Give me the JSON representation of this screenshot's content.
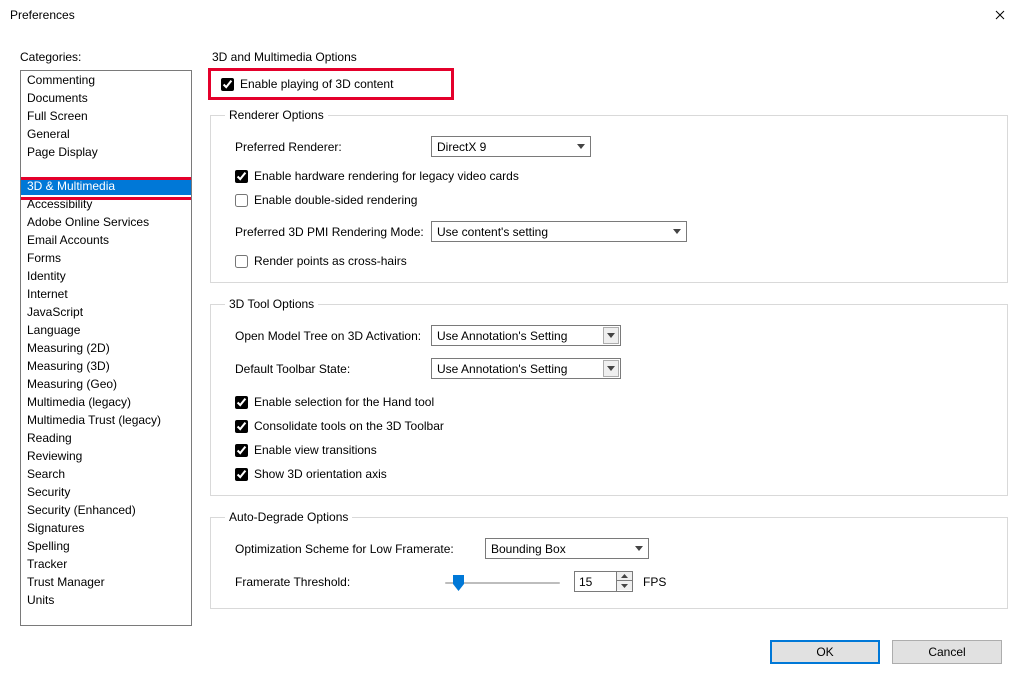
{
  "window": {
    "title": "Preferences"
  },
  "sidebar": {
    "label": "Categories:",
    "group1": [
      "Commenting",
      "Documents",
      "Full Screen",
      "General",
      "Page Display"
    ],
    "group2": [
      "3D & Multimedia",
      "Accessibility",
      "Adobe Online Services",
      "Email Accounts",
      "Forms",
      "Identity",
      "Internet",
      "JavaScript",
      "Language",
      "Measuring (2D)",
      "Measuring (3D)",
      "Measuring (Geo)",
      "Multimedia (legacy)",
      "Multimedia Trust (legacy)",
      "Reading",
      "Reviewing",
      "Search",
      "Security",
      "Security (Enhanced)",
      "Signatures",
      "Spelling",
      "Tracker",
      "Trust Manager",
      "Units"
    ],
    "selected": "3D & Multimedia"
  },
  "main": {
    "title": "3D and Multimedia Options",
    "enable3d": {
      "label": "Enable playing of 3D content",
      "checked": true
    },
    "renderer": {
      "legend": "Renderer Options",
      "preferred_label": "Preferred Renderer:",
      "preferred_value": "DirectX 9",
      "hw_legacy": {
        "label": "Enable hardware rendering for legacy video cards",
        "checked": true
      },
      "double_sided": {
        "label": "Enable double-sided rendering",
        "checked": false
      },
      "pmi_label": "Preferred 3D PMI Rendering Mode:",
      "pmi_value": "Use content's setting",
      "crosshairs": {
        "label": "Render points as cross-hairs",
        "checked": false
      }
    },
    "tool": {
      "legend": "3D Tool Options",
      "modeltree_label": "Open Model Tree on 3D Activation:",
      "modeltree_value": "Use Annotation's Setting",
      "toolbar_label": "Default Toolbar State:",
      "toolbar_value": "Use Annotation's Setting",
      "hand_select": {
        "label": "Enable selection for the Hand tool",
        "checked": true
      },
      "consolidate": {
        "label": "Consolidate tools on the 3D Toolbar",
        "checked": true
      },
      "transitions": {
        "label": "Enable view transitions",
        "checked": true
      },
      "orientation": {
        "label": "Show 3D orientation axis",
        "checked": true
      }
    },
    "autodegrade": {
      "legend": "Auto-Degrade Options",
      "scheme_label": "Optimization Scheme for Low Framerate:",
      "scheme_value": "Bounding Box",
      "threshold_label": "Framerate Threshold:",
      "threshold_value": "15",
      "threshold_unit": "FPS"
    }
  },
  "footer": {
    "ok": "OK",
    "cancel": "Cancel"
  }
}
